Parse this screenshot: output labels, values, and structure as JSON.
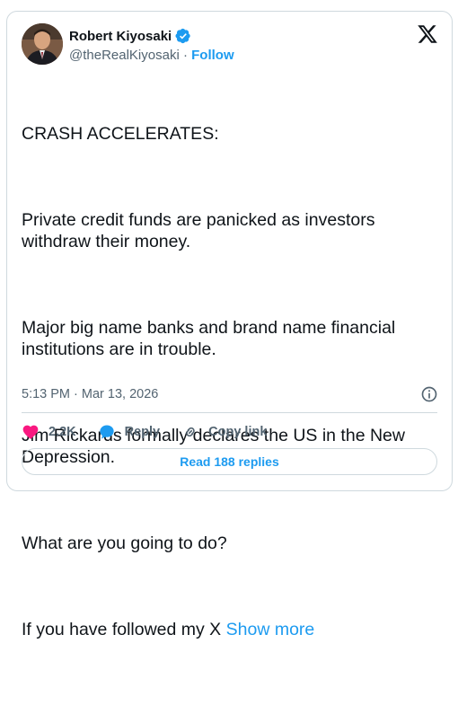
{
  "author": {
    "name": "Robert Kiyosaki",
    "handle": "@theRealKiyosaki",
    "separator": " · ",
    "follow_label": "Follow"
  },
  "tweet": {
    "paragraphs": [
      "CRASH ACCELERATES:",
      "Private credit funds are panicked as investors withdraw their money.",
      "Major big name banks and brand name financial institutions are in trouble.",
      "Jim Rickards formally declares the US in the New Depression.",
      "What are you going to do?"
    ],
    "last_line": "If you have followed my X ",
    "show_more_label": "Show more",
    "timestamp": "5:13 PM · Mar 13, 2026"
  },
  "actions": {
    "likes_count": "2.2K",
    "reply_label": "Reply",
    "copy_link_label": "Copy link",
    "read_replies_label": "Read 188 replies"
  },
  "icons": {
    "verified": "verified-badge-icon",
    "x_logo": "x-logo-icon",
    "info": "info-icon",
    "like": "heart-icon",
    "reply": "reply-bubble-icon",
    "copy_link": "link-icon"
  },
  "colors": {
    "accent": "#1d9bf0",
    "like": "#f91880",
    "text": "#0f1419",
    "secondary": "#536471",
    "border": "#cfd9de"
  }
}
